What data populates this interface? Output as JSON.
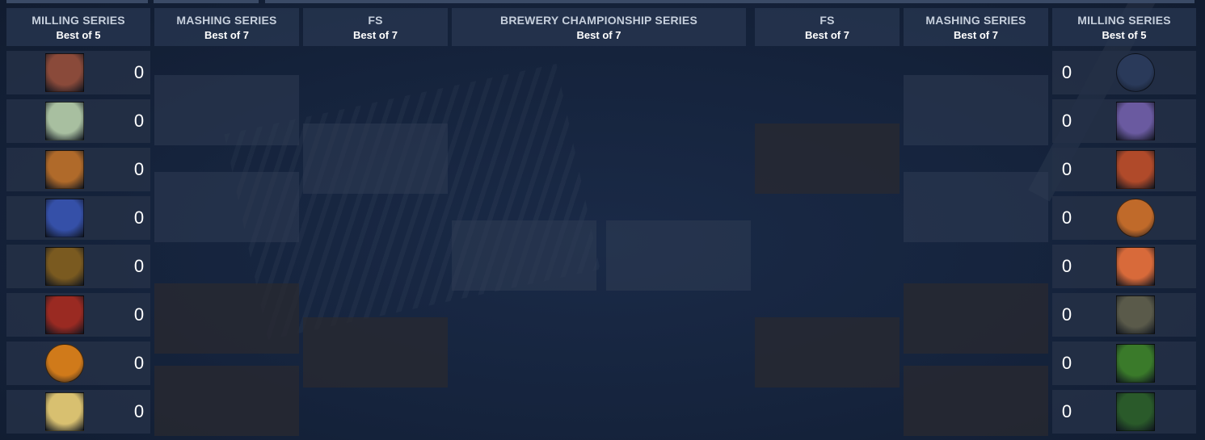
{
  "bracket": {
    "rounds_left": [
      {
        "title": "MILLING SERIES",
        "sub": "Best of 5"
      },
      {
        "title": "MASHING SERIES",
        "sub": "Best of 7"
      },
      {
        "title": "FS",
        "sub": "Best of 7"
      }
    ],
    "final": {
      "title": "BREWERY CHAMPIONSHIP SERIES",
      "sub": "Best of 7"
    },
    "rounds_right": [
      {
        "title": "FS",
        "sub": "Best of 7"
      },
      {
        "title": "MASHING SERIES",
        "sub": "Best of 7"
      },
      {
        "title": "MILLING SERIES",
        "sub": "Best of 5"
      }
    ]
  },
  "seeds_left": [
    {
      "score": "0",
      "logo": "weathered-circus-label",
      "color": "#8a4a3a"
    },
    {
      "score": "0",
      "logo": "giant-robot-hop-label",
      "color": "#a8bfa0"
    },
    {
      "score": "0",
      "logo": "unspeakably-label",
      "color": "#b06a2a"
    },
    {
      "score": "0",
      "logo": "blue-figure-label",
      "color": "#3550a8"
    },
    {
      "score": "0",
      "logo": "iron-bewley-label",
      "color": "#7a5a20"
    },
    {
      "score": "0",
      "logo": "red-curtain-label",
      "color": "#9a2a22"
    },
    {
      "score": "0",
      "logo": "orange-fish-badge",
      "color": "#d07a1a"
    },
    {
      "score": "0",
      "logo": "yellow-nut-label",
      "color": "#d8c070"
    }
  ],
  "seeds_right": [
    {
      "score": "0",
      "logo": "kingfish-ale-badge",
      "color": "#2a3a5a"
    },
    {
      "score": "0",
      "logo": "purple-ship-label",
      "color": "#6a5aa0"
    },
    {
      "score": "0",
      "logo": "red-skull-label",
      "color": "#b04a2a"
    },
    {
      "score": "0",
      "logo": "orange-face-badge",
      "color": "#c06a2a"
    },
    {
      "score": "0",
      "logo": "orange-mountain-label",
      "color": "#d86a3a"
    },
    {
      "score": "0",
      "logo": "skull-crest-label",
      "color": "#5a5a4a"
    },
    {
      "score": "0",
      "logo": "blind-pig-label",
      "color": "#3a7a2a"
    },
    {
      "score": "0",
      "logo": "terrapin-label",
      "color": "#2a5a2a"
    }
  ]
}
